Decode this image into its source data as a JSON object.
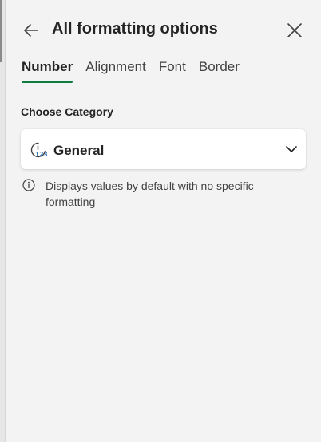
{
  "header": {
    "title": "All formatting options",
    "back_icon": "arrow-left-icon",
    "close_icon": "close-icon"
  },
  "tabs": [
    {
      "label": "Number",
      "active": true
    },
    {
      "label": "Alignment",
      "active": false
    },
    {
      "label": "Font",
      "active": false
    },
    {
      "label": "Border",
      "active": false
    }
  ],
  "category": {
    "section_label": "Choose Category",
    "selected": "General",
    "icon": "general-number-format-icon",
    "chevron_icon": "chevron-down-icon",
    "icon_text": "123"
  },
  "info": {
    "icon": "info-icon",
    "text": "Displays values by default with no specific formatting"
  },
  "colors": {
    "accent": "#107c41",
    "background": "#f3f3f3",
    "card": "#ffffff",
    "text": "#242424"
  }
}
